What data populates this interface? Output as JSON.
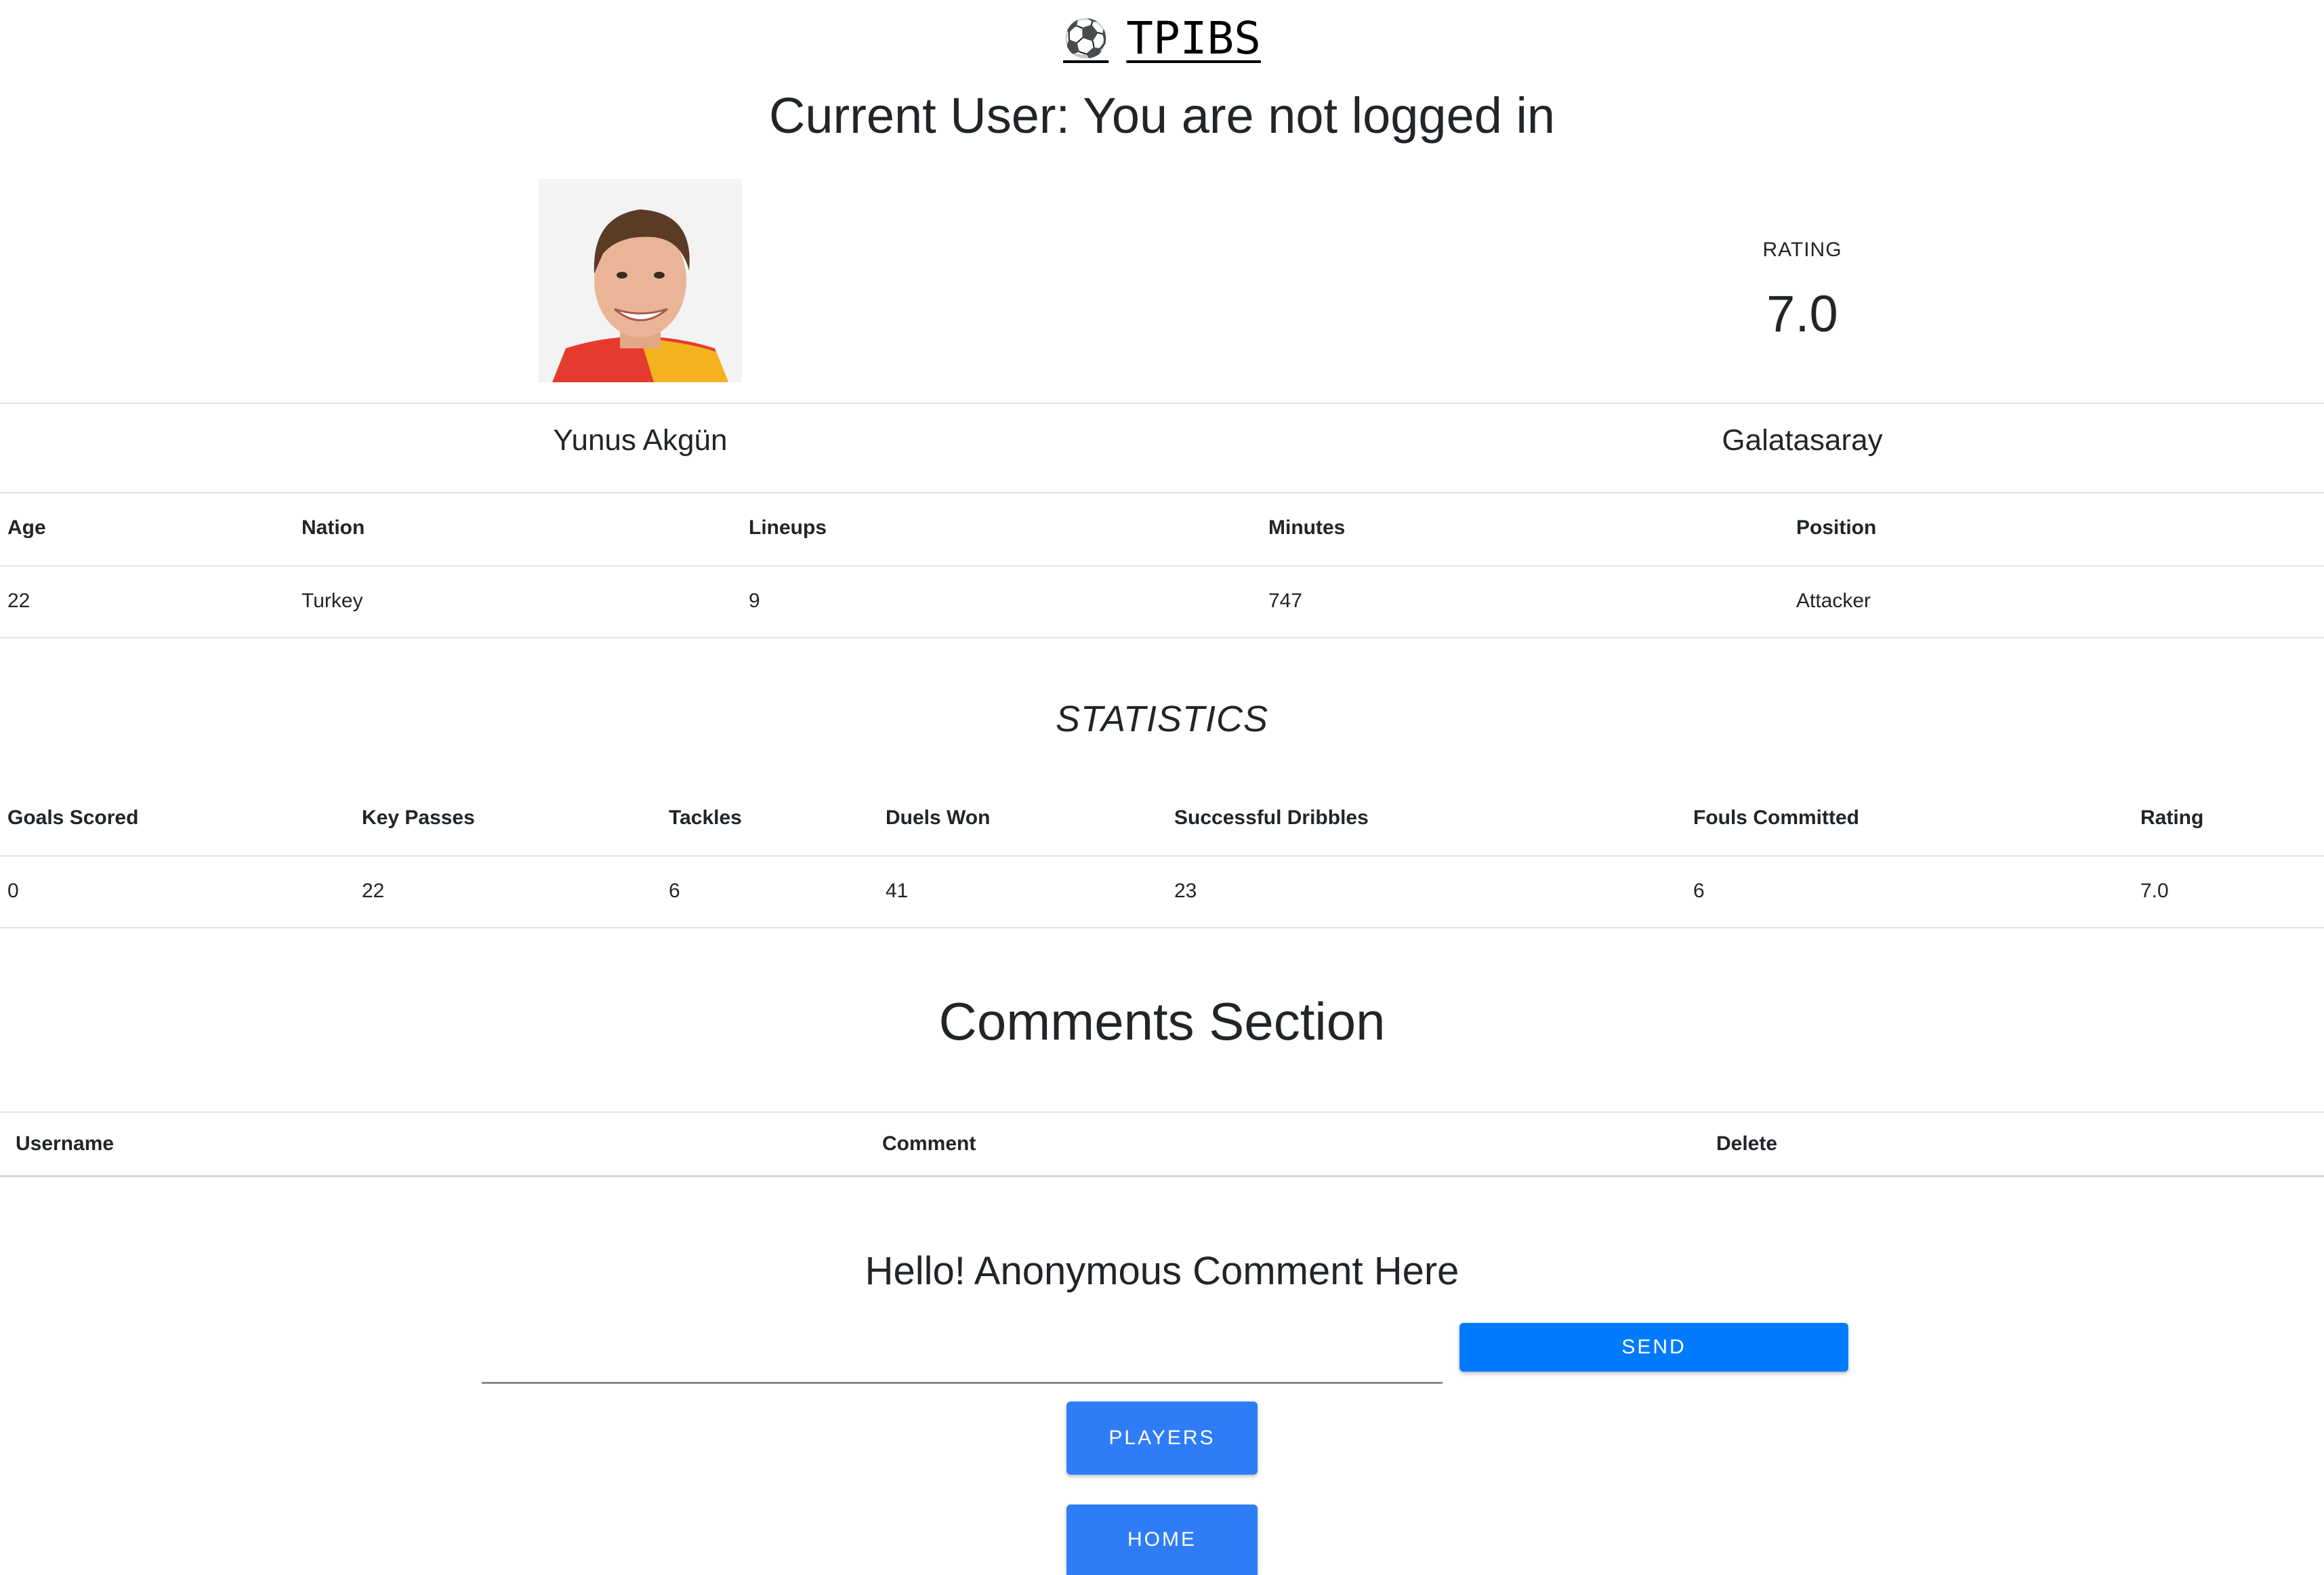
{
  "header": {
    "brand_icon": "soccer-ball-icon",
    "brand_title": "TPIBS",
    "current_user": "Current User: You are not logged in"
  },
  "profile": {
    "rating_label": "RATING",
    "rating_value": "7.0",
    "name": "Yunus Akgün",
    "club": "Galatasaray"
  },
  "info_table": {
    "headers": [
      "Age",
      "Nation",
      "Lineups",
      "Minutes",
      "Position"
    ],
    "row": [
      "22",
      "Turkey",
      "9",
      "747",
      "Attacker"
    ]
  },
  "statistics": {
    "title": "STATISTICS",
    "headers": [
      "Goals Scored",
      "Key Passes",
      "Tackles",
      "Duels Won",
      "Successful Dribbles",
      "Fouls Committed",
      "Rating"
    ],
    "row": [
      "0",
      "22",
      "6",
      "41",
      "23",
      "6",
      "7.0"
    ]
  },
  "comments": {
    "title": "Comments Section",
    "headers": [
      "Username",
      "Comment",
      "Delete"
    ]
  },
  "form": {
    "prompt": "Hello! Anonymous Comment Here",
    "input_value": "",
    "send_label": "SEND"
  },
  "nav": {
    "players_label": "PLAYERS",
    "home_label": "HOME"
  }
}
